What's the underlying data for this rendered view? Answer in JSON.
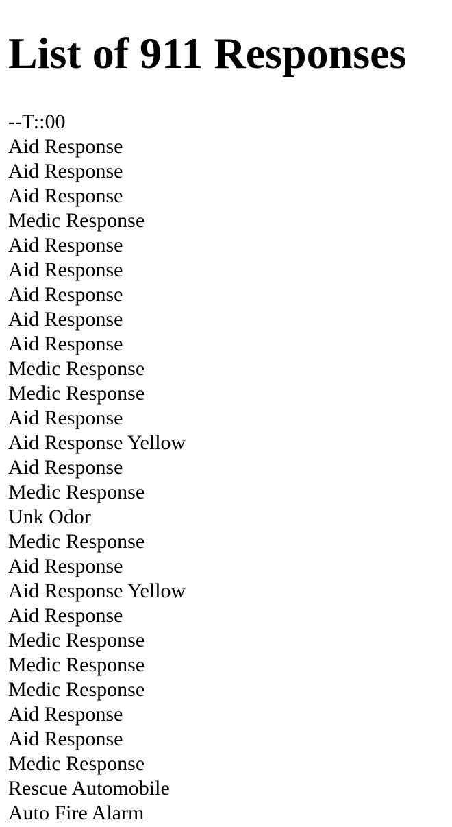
{
  "page": {
    "title": "List of 911 Responses",
    "timestamp": "--T::00",
    "responses": [
      "Aid Response",
      "Aid Response",
      "Aid Response",
      "Medic Response",
      "Aid Response",
      "Aid Response",
      "Aid Response",
      "Aid Response",
      "Aid Response",
      "Medic Response",
      "Medic Response",
      "Aid Response",
      "Aid Response Yellow",
      "Aid Response",
      "Medic Response",
      "Unk Odor",
      "Medic Response",
      "Aid Response",
      "Aid Response Yellow",
      "Aid Response",
      "Medic Response",
      "Medic Response",
      "Medic Response",
      "Aid Response",
      "Aid Response",
      "Medic Response",
      "Rescue Automobile",
      "Auto Fire Alarm"
    ]
  }
}
